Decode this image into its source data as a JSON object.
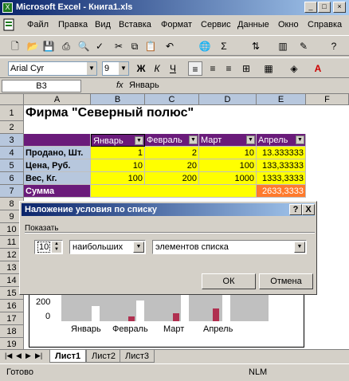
{
  "window": {
    "title": "Microsoft Excel - Книга1.xls"
  },
  "menu": {
    "items": [
      "Файл",
      "Правка",
      "Вид",
      "Вставка",
      "Формат",
      "Сервис",
      "Данные",
      "Окно",
      "Справка"
    ]
  },
  "toolbar": {
    "font_name": "Arial Cyr",
    "font_size": "9",
    "sigma": "Σ",
    "italic": "К",
    "bold": "Ж",
    "underline": "Ч"
  },
  "formula": {
    "cell_ref": "B3",
    "fx": "fx",
    "content": "Январь"
  },
  "sheet": {
    "columns": [
      "A",
      "B",
      "C",
      "D",
      "E",
      "F"
    ],
    "rows": [
      "1",
      "2",
      "3",
      "4",
      "5",
      "6",
      "7",
      "8",
      "9",
      "10",
      "11",
      "12",
      "13",
      "14",
      "15",
      "16",
      "17",
      "18",
      "19"
    ],
    "title": "Фирма \"Северный полюс\"",
    "headers": [
      "Январь",
      "Февраль",
      "Март",
      "Апрель"
    ],
    "row_labels": [
      "Продано, Шт.",
      "Цена, Руб.",
      "Вес, Кг.",
      "Сумма"
    ],
    "values": [
      [
        "1",
        "2",
        "10",
        "13.333333"
      ],
      [
        "10",
        "20",
        "100",
        "133,33333"
      ],
      [
        "100",
        "200",
        "1000",
        "1333,3333"
      ]
    ],
    "sum": "2633,3333",
    "chart_labels": [
      "Январь",
      "Февраль",
      "Март",
      "Апрель"
    ],
    "chart_ticks": [
      "200",
      "0"
    ]
  },
  "colors": {
    "header_fill": "#6a1b7a",
    "yellow": "#ffff00",
    "sum_row": "#b7c7dd",
    "sum_value": "#ff7a2c"
  },
  "tabs": [
    "Лист1",
    "Лист2",
    "Лист3"
  ],
  "status": {
    "left": "Готово",
    "right": "NLM"
  },
  "dialog": {
    "title": "Наложение условия по списку",
    "help": "?",
    "close": "X",
    "group_label": "Показать",
    "count": "10",
    "which": "наибольших",
    "type": "элементов списка",
    "ok": "ОК",
    "cancel": "Отмена"
  }
}
